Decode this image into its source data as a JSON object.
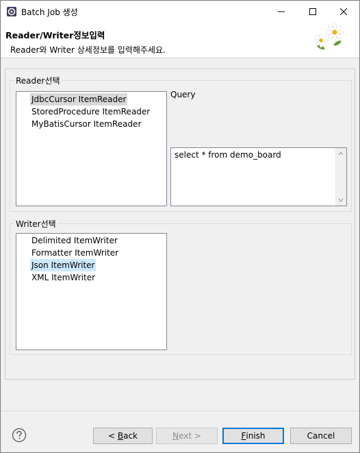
{
  "window": {
    "title": "Batch Job 생성"
  },
  "header": {
    "title": "Reader/Writer정보입력",
    "description": "Reader와 Writer 상세정보를 입력해주세요."
  },
  "reader": {
    "group_label": "Reader선택",
    "items": [
      "JdbcCursor ItemReader",
      "StoredProcedure ItemReader",
      "MyBatisCursor ItemReader"
    ],
    "selected": "JdbcCursor ItemReader",
    "query_label": "Query",
    "query_value": "select * from demo_board"
  },
  "writer": {
    "group_label": "Writer선택",
    "items": [
      "Delimited ItemWriter",
      "Formatter ItemWriter",
      "Json ItemWriter",
      "XML ItemWriter"
    ],
    "selected": "Json ItemWriter"
  },
  "footer": {
    "back_prefix": "< ",
    "back_mnemonic": "B",
    "back_rest": "ack",
    "next_mnemonic": "N",
    "next_rest": "ext >",
    "finish_mnemonic": "F",
    "finish_rest": "inish",
    "cancel": "Cancel"
  },
  "colors": {
    "selection_gray": "#d9d9d9",
    "selection_blue": "#cce8ff",
    "default_button_border": "#0078d7"
  }
}
